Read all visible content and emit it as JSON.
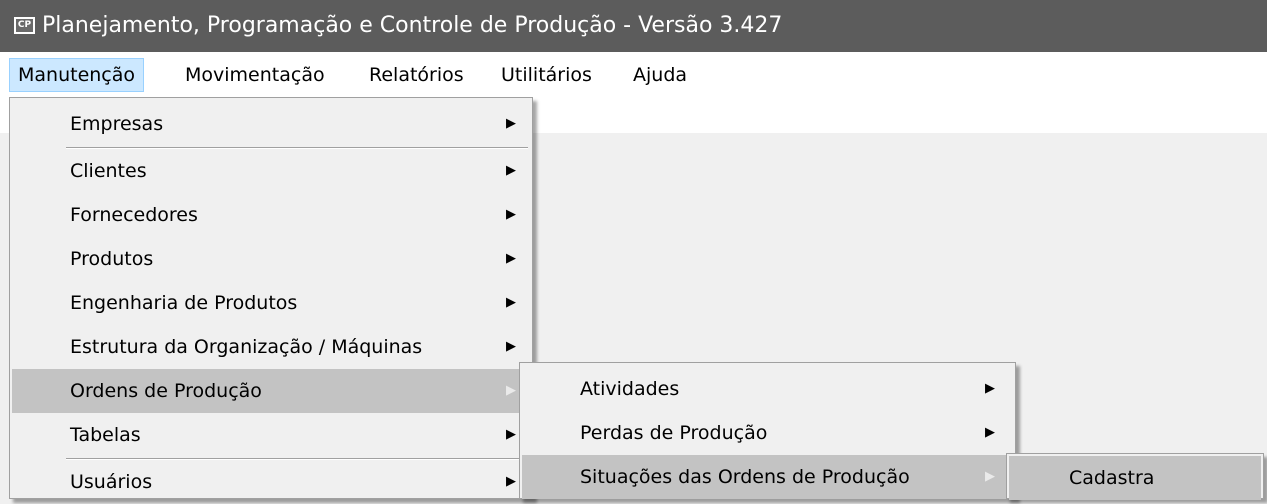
{
  "window": {
    "title": "Planejamento, Programação e Controle de Produção - Versão 3.427",
    "icon_text": "CP"
  },
  "menubar": {
    "items": [
      {
        "label": "Manutenção",
        "active": true
      },
      {
        "label": "Movimentação"
      },
      {
        "label": "Relatórios"
      },
      {
        "label": "Utilitários"
      },
      {
        "label": "Ajuda"
      }
    ]
  },
  "menu_manutencao": {
    "items": [
      {
        "label": "Empresas",
        "arrow": "▶"
      },
      {
        "label": "Clientes",
        "arrow": "▶"
      },
      {
        "label": "Fornecedores",
        "arrow": "▶"
      },
      {
        "label": "Produtos",
        "arrow": "▶"
      },
      {
        "label": "Engenharia de Produtos",
        "arrow": "▶"
      },
      {
        "label": "Estrutura da Organização / Máquinas",
        "arrow": "▶"
      },
      {
        "label": "Ordens de Produção",
        "arrow": "▶",
        "highlighted": true
      },
      {
        "label": "Tabelas",
        "arrow": "▶"
      },
      {
        "label": "Usuários",
        "arrow": "▶"
      }
    ]
  },
  "menu_ordens": {
    "items": [
      {
        "label": "Atividades",
        "arrow": "▶"
      },
      {
        "label": "Perdas de Produção",
        "arrow": "▶"
      },
      {
        "label": "Situações das Ordens de Produção",
        "arrow": "▶",
        "highlighted": true
      }
    ]
  },
  "menu_situacoes": {
    "items": [
      {
        "label": "Cadastra",
        "highlighted": true
      }
    ]
  }
}
